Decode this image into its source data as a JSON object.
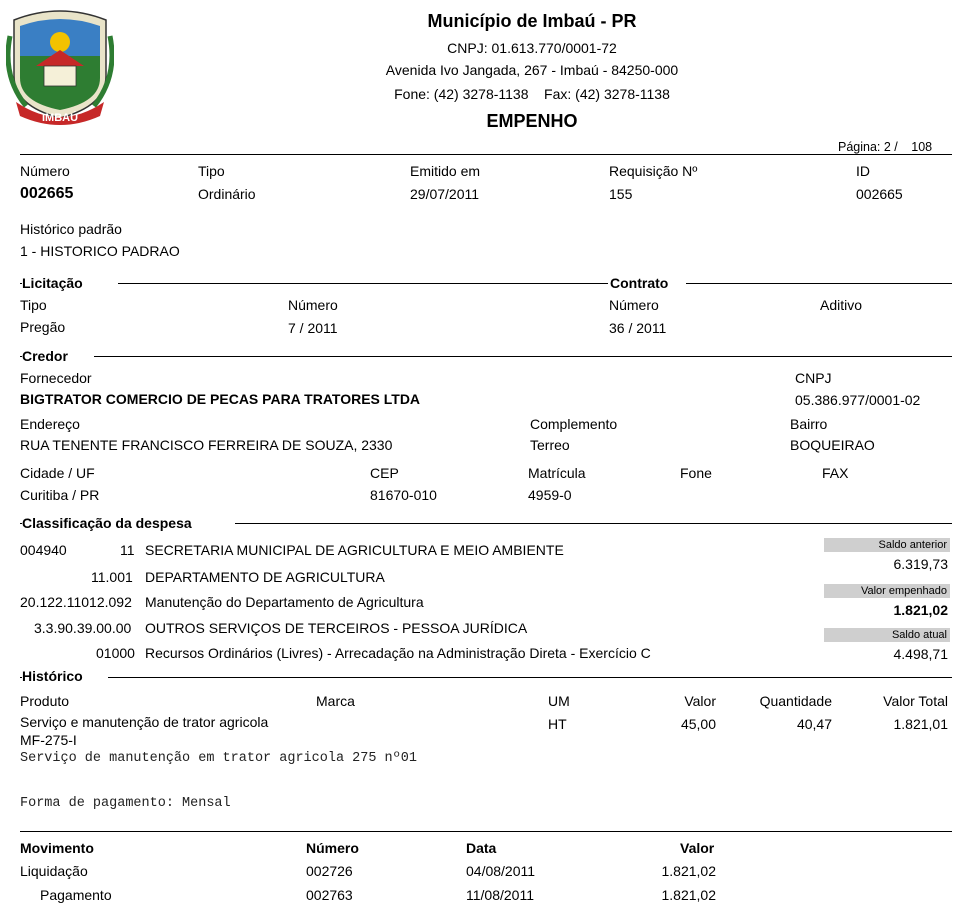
{
  "header": {
    "municipality": "Município de Imbaú - PR",
    "cnpj": "CNPJ: 01.613.770/0001-72",
    "address": "Avenida Ivo Jangada, 267 - Imbaú - 84250-000",
    "phones": "Fone: (42) 3278-1138    Fax: (42) 3278-1138",
    "doc_title": "EMPENHO",
    "page": "Página: 2 /",
    "page_total": "108",
    "logo_text": "IMBAÚ"
  },
  "empenho": {
    "labels": {
      "numero": "Número",
      "tipo": "Tipo",
      "emitido": "Emitido em",
      "requisicao": "Requisição Nº",
      "id": "ID"
    },
    "numero": "002665",
    "tipo": "Ordinário",
    "emitido": "29/07/2011",
    "requisicao": "155",
    "id": "002665"
  },
  "historico_padrao": {
    "label": "Histórico padrão",
    "value": "1 - HISTORICO PADRAO"
  },
  "licitacao": {
    "title": "Licitação",
    "tipo_label": "Tipo",
    "tipo": "Pregão",
    "numero_label": "Número",
    "numero": "7 / 2011"
  },
  "contrato": {
    "title": "Contrato",
    "numero_label": "Número",
    "numero": "36 / 2011",
    "aditivo_label": "Aditivo"
  },
  "credor": {
    "title": "Credor",
    "fornecedor_label": "Fornecedor",
    "fornecedor": "BIGTRATOR COMERCIO DE PECAS PARA TRATORES LTDA",
    "cnpj_label": "CNPJ",
    "cnpj": "05.386.977/0001-02",
    "endereco_label": "Endereço",
    "endereco": "RUA TENENTE FRANCISCO FERREIRA DE SOUZA, 2330",
    "complemento_label": "Complemento",
    "complemento": "Terreo",
    "bairro_label": "Bairro",
    "bairro": "BOQUEIRAO",
    "cidade_label": "Cidade / UF",
    "cidade": "Curitiba / PR",
    "cep_label": "CEP",
    "cep": "81670-010",
    "matricula_label": "Matrícula",
    "matricula": "4959-0",
    "fone_label": "Fone",
    "fax_label": "FAX"
  },
  "classificacao": {
    "title": "Classificação da despesa",
    "lines": [
      {
        "code": "004940",
        "sub": "11",
        "desc": "SECRETARIA MUNICIPAL DE AGRICULTURA E MEIO AMBIENTE"
      },
      {
        "code": "11.001",
        "desc": "DEPARTAMENTO DE AGRICULTURA"
      },
      {
        "code": "20.122.11012.092",
        "desc": "Manutenção do Departamento de Agricultura"
      },
      {
        "code": "3.3.90.39.00.00",
        "desc": "OUTROS SERVIÇOS DE TERCEIROS - PESSOA JURÍDICA"
      },
      {
        "code": "01000",
        "desc": "Recursos Ordinários (Livres) - Arrecadação na Administração Direta - Exercício C"
      }
    ]
  },
  "saldos": {
    "anterior_label": "Saldo anterior",
    "anterior": "6.319,73",
    "empenhado_label": "Valor empenhado",
    "empenhado": "1.821,02",
    "atual_label": "Saldo atual",
    "atual": "4.498,71"
  },
  "historico": {
    "title": "Histórico",
    "columns": [
      "Produto",
      "Marca",
      "UM",
      "Valor",
      "Quantidade",
      "Valor Total"
    ],
    "item": {
      "produto": "Serviço e manutenção de trator agricola",
      "produto_code": "MF-275-I",
      "um": "HT",
      "valor": "45,00",
      "quantidade": "40,47",
      "total": "1.821,01"
    },
    "descricao": "Serviço de manutenção em trator agricola 275 nº01",
    "forma_pagamento": "Forma de pagamento: Mensal"
  },
  "movimentos": {
    "columns": [
      "Movimento",
      "Número",
      "Data",
      "Valor"
    ],
    "rows": [
      {
        "movimento": "Liquidação",
        "numero": "002726",
        "data": "04/08/2011",
        "valor": "1.821,02"
      },
      {
        "movimento": "Pagamento",
        "numero": "002763",
        "data": "11/08/2011",
        "valor": "1.821,02"
      }
    ]
  },
  "colors": {
    "text": "#000000",
    "box_gray": "#cfcfcf",
    "logo_green": "#2e7d32",
    "logo_yellow": "#f2c200",
    "logo_red": "#c62828"
  }
}
